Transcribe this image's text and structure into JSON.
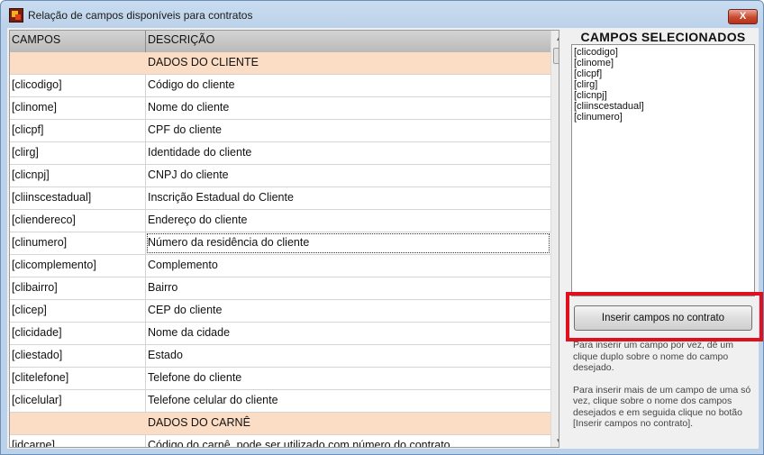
{
  "window": {
    "title": "Relação de campos disponíveis para contratos",
    "close_label": "X"
  },
  "grid": {
    "columns": [
      "CAMPOS",
      "DESCRIÇÃO"
    ],
    "rows": [
      {
        "campo": "",
        "descricao": "DADOS DO CLIENTE",
        "section": true
      },
      {
        "campo": "[clicodigo]",
        "descricao": "Código do cliente"
      },
      {
        "campo": "[clinome]",
        "descricao": "Nome do cliente"
      },
      {
        "campo": "[clicpf]",
        "descricao": "CPF do cliente"
      },
      {
        "campo": "[clirg]",
        "descricao": "Identidade do cliente"
      },
      {
        "campo": "[clicnpj]",
        "descricao": "CNPJ do cliente"
      },
      {
        "campo": "[cliinscestadual]",
        "descricao": "Inscrição Estadual do Cliente"
      },
      {
        "campo": "[cliendereco]",
        "descricao": "Endereço do cliente"
      },
      {
        "campo": "[clinumero]",
        "descricao": "Número da residência do cliente",
        "focused": true
      },
      {
        "campo": "[clicomplemento]",
        "descricao": "Complemento"
      },
      {
        "campo": "[clibairro]",
        "descricao": "Bairro"
      },
      {
        "campo": "[clicep]",
        "descricao": "CEP do cliente"
      },
      {
        "campo": "[clicidade]",
        "descricao": "Nome da cidade"
      },
      {
        "campo": "[cliestado]",
        "descricao": "Estado"
      },
      {
        "campo": "[clitelefone]",
        "descricao": "Telefone do cliente"
      },
      {
        "campo": "[clicelular]",
        "descricao": "Telefone celular do cliente"
      },
      {
        "campo": "",
        "descricao": "DADOS DO CARNÊ",
        "section": true
      },
      {
        "campo": "[idcarne]",
        "descricao": "Código do carnê, pode ser utilizado com número do contrato."
      }
    ]
  },
  "selected": {
    "title": "CAMPOS SELECIONADOS",
    "items": [
      "[clicodigo]",
      "[clinome]",
      "[clicpf]",
      "[clirg]",
      "[clicnpj]",
      "[cliinscestadual]",
      "[clinumero]"
    ]
  },
  "insert_button": {
    "label": "Inserir campos no contrato"
  },
  "help": {
    "paragraph1": "Para inserir um campo por vez, dê um clique duplo sobre o nome do campo desejado.",
    "paragraph2": "Para inserir mais de um campo de uma só vez, clique sobre o nome dos campos desejados e em seguida clique no botão [Inserir campos no contrato]."
  },
  "colors": {
    "section_row": "#fbdcc4",
    "highlight_border": "#e0101c",
    "close_button": "#c9492f"
  }
}
